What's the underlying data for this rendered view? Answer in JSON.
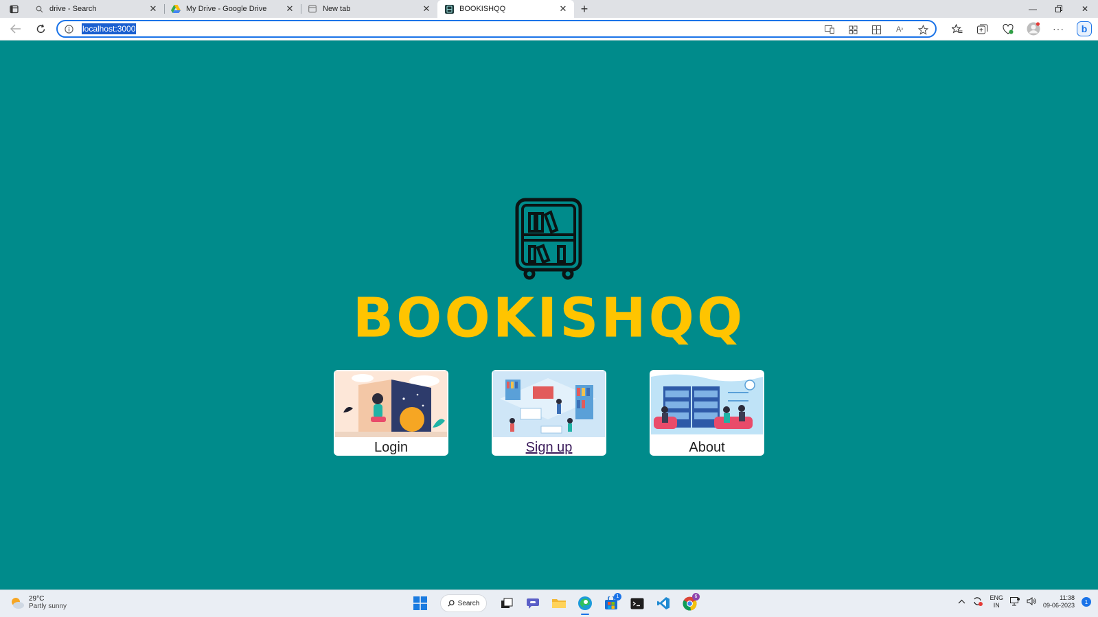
{
  "browser": {
    "tabs": [
      {
        "title": "drive - Search",
        "icon": "search-icon",
        "active": false
      },
      {
        "title": "My Drive - Google Drive",
        "icon": "google-drive-icon",
        "active": false
      },
      {
        "title": "New tab",
        "icon": "new-tab-page-icon",
        "active": false
      },
      {
        "title": "BOOKISHQQ",
        "icon": "bookshelf-icon",
        "active": true
      }
    ],
    "address": "localhost:3000"
  },
  "page": {
    "brand": "BOOKISHQQ",
    "cards": [
      {
        "label": "Login",
        "illustration": "reading-girl-illustration"
      },
      {
        "label": "Sign up",
        "illustration": "library-isometric-illustration"
      },
      {
        "label": "About",
        "illustration": "library-readers-illustration"
      }
    ],
    "colors": {
      "background": "#008b8b",
      "brand": "#ffc400",
      "card": "#ffffff"
    }
  },
  "taskbar": {
    "weather": {
      "temp": "29°C",
      "condition": "Partly sunny"
    },
    "search_label": "Search",
    "store_badge": "1",
    "chrome_badge": "6",
    "tray": {
      "lang_top": "ENG",
      "lang_bottom": "IN",
      "time": "11:38",
      "date": "09-06-2023",
      "notifications": "1"
    }
  }
}
